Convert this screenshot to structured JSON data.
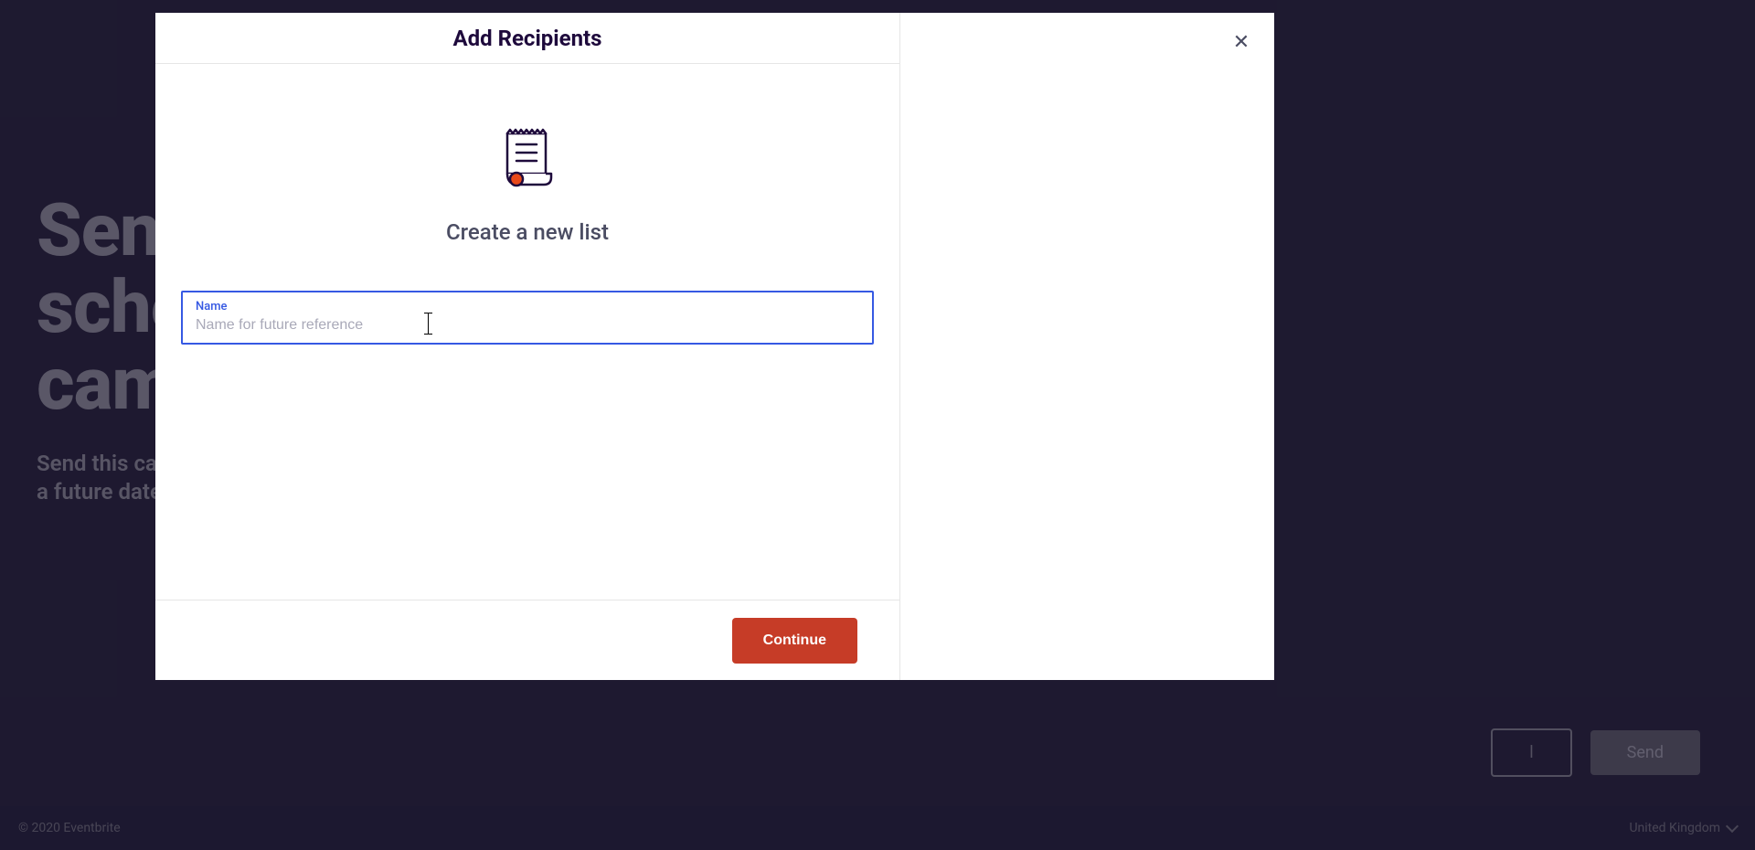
{
  "background": {
    "heading_line1": "Send",
    "heading_line2": "sche",
    "heading_line3": "camp",
    "subtext_line1": "Send this cam",
    "subtext_line2": "a future date a",
    "cancel_label": "l",
    "send_label": "Send"
  },
  "footer": {
    "copyright": "© 2020 Eventbrite",
    "locale": "United Kingdom"
  },
  "modal": {
    "title": "Add Recipients",
    "close_symbol": "✕",
    "heading": "Create a new list",
    "input": {
      "label": "Name",
      "placeholder": "Name for future reference",
      "value": ""
    },
    "continue_label": "Continue"
  }
}
